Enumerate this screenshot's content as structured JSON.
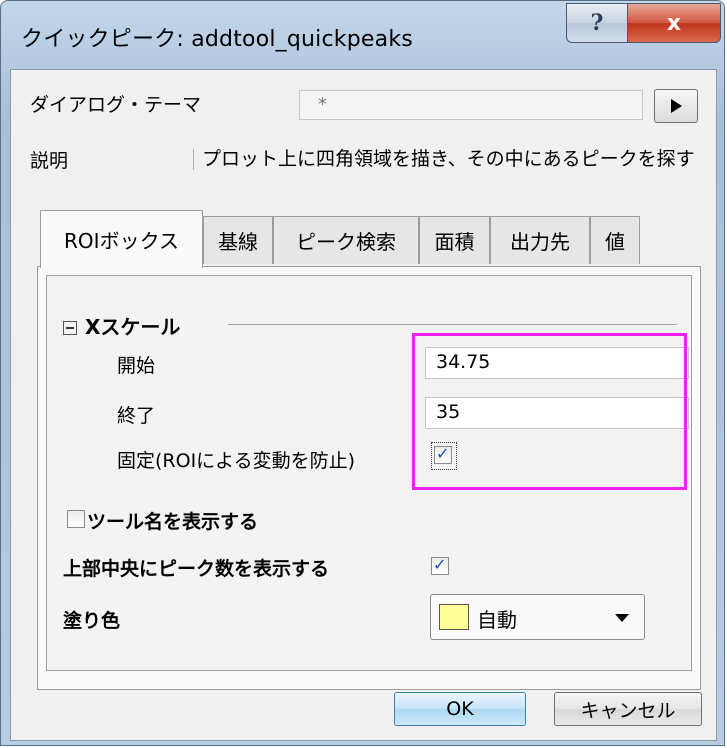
{
  "window": {
    "title": "クイックピーク: addtool_quickpeaks",
    "help_glyph": "?",
    "close_glyph": "x"
  },
  "theme": {
    "label": "ダイアログ・テーマ",
    "value": "*"
  },
  "description": {
    "label": "説明",
    "text": "プロット上に四角領域を描き、その中にあるピークを探す"
  },
  "tabs": [
    {
      "label": "ROIボックス",
      "active": true
    },
    {
      "label": "基線",
      "active": false
    },
    {
      "label": "ピーク検索",
      "active": false
    },
    {
      "label": "面積",
      "active": false
    },
    {
      "label": "出力先",
      "active": false
    },
    {
      "label": "値",
      "active": false
    }
  ],
  "xscale": {
    "heading": "Xスケール",
    "start_label": "開始",
    "start_value": "34.75",
    "end_label": "終了",
    "end_value": "35",
    "fixed_label": "固定(ROIによる変動を防止)",
    "fixed_checked": true
  },
  "options": {
    "show_tool_name_label": "ツール名を表示する",
    "show_tool_name_checked": false,
    "show_peak_count_label": "上部中央にピーク数を表示する",
    "show_peak_count_checked": true,
    "fill_color_label": "塗り色",
    "fill_color_value": "自動",
    "fill_color_swatch": "#ffff99"
  },
  "buttons": {
    "ok": "OK",
    "cancel": "キャンセル"
  },
  "colors": {
    "highlight": "#ee22ee",
    "close_button": "#c1341b"
  }
}
